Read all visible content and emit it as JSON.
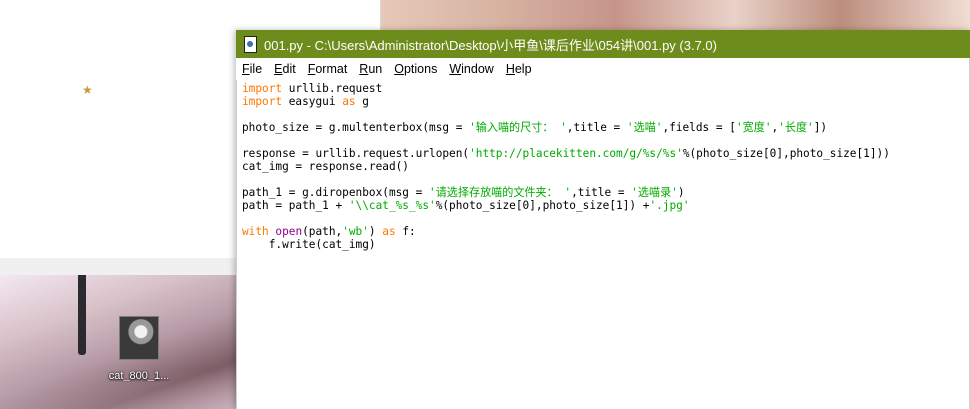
{
  "idle_window": {
    "title": "001.py - C:\\Users\\Administrator\\Desktop\\小甲鱼\\课后作业\\054讲\\001.py (3.7.0)",
    "title_bar_color": "#6d8c1b",
    "menu": [
      {
        "first": "F",
        "rest": "ile"
      },
      {
        "first": "E",
        "rest": "dit"
      },
      {
        "first": "F",
        "rest": "ormat"
      },
      {
        "first": "R",
        "rest": "un"
      },
      {
        "first": "O",
        "rest": "ptions"
      },
      {
        "first": "W",
        "rest": "indow"
      },
      {
        "first": "H",
        "rest": "elp"
      }
    ]
  },
  "code": {
    "l1_kw": "import",
    "l1_rest": " urllib.request",
    "l2_kw": "import",
    "l2_mid": " easygui ",
    "l2_kw2": "as",
    "l2_rest": " g",
    "l4_a": "photo_size = g.multenterbox(msg = ",
    "l4_s1": "'输入喵的尺寸： '",
    "l4_b": ",title = ",
    "l4_s2": "'选喵'",
    "l4_c": ",fields = [",
    "l4_s3": "'宽度'",
    "l4_d": ",",
    "l4_s4": "'长度'",
    "l4_e": "])",
    "l6_a": "response = urllib.request.urlopen(",
    "l6_s1": "'http://placekitten.com/g/%s/%s'",
    "l6_b": "%(photo_size[0],photo_size[1]))",
    "l7": "cat_img = response.read()",
    "l9_a": "path_1 = g.diropenbox(msg = ",
    "l9_s1": "'请选择存放喵的文件夹： '",
    "l9_b": ",title = ",
    "l9_s2": "'选喵录'",
    "l9_c": ")",
    "l10_a": "path = path_1 + ",
    "l10_s1": "'\\\\cat_%s_%s'",
    "l10_b": "%(photo_size[0],photo_size[1]) +",
    "l10_s2": "'.jpg'",
    "l12_kw": "with",
    "l12_sp": " ",
    "l12_bi": "open",
    "l12_a": "(path,",
    "l12_s1": "'wb'",
    "l12_b": ") ",
    "l12_kw2": "as",
    "l12_c": " f:",
    "l13": "    f.write(cat_img)"
  },
  "desktop_icon": {
    "label": "cat_800_1..."
  }
}
